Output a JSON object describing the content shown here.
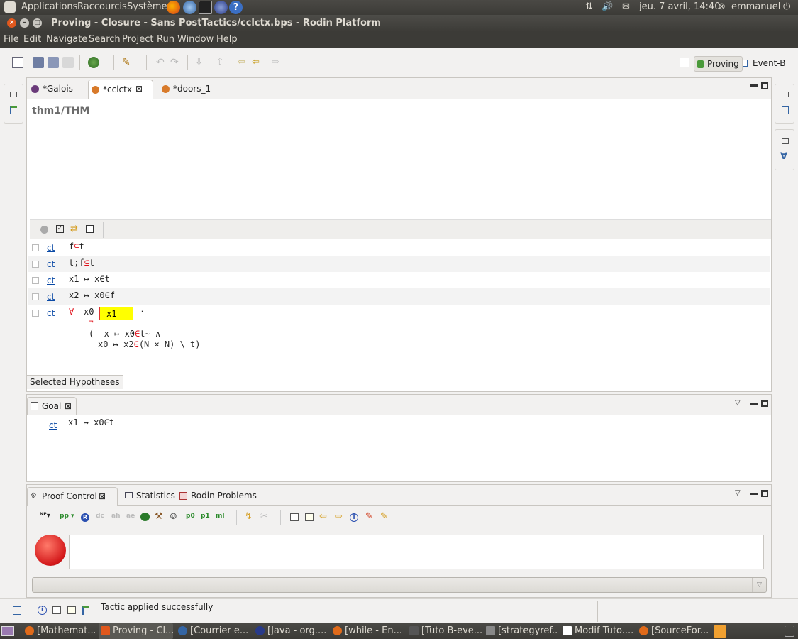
{
  "top_panel": {
    "applications": "Applications",
    "shortcuts": "Raccourcis",
    "system": "Système",
    "datetime": "jeu. 7 avril, 14:40",
    "user": "emmanuel"
  },
  "window": {
    "title": "Proving - Closure - Sans PostTactics/cclctx.bps - Rodin Platform"
  },
  "menu": {
    "items": [
      "File",
      "Edit",
      "Navigate",
      "Search",
      "Project",
      "Run",
      "Window",
      "Help"
    ]
  },
  "perspectives": {
    "proving": "Proving",
    "eventb": "Event-B"
  },
  "editor": {
    "tabs": [
      {
        "label": "*Galois"
      },
      {
        "label": "*cclctx"
      },
      {
        "label": "*doors_1"
      }
    ],
    "title": "thm1/THM",
    "hypotheses_label": "Selected Hypotheses",
    "hypotheses": [
      {
        "link": "ct",
        "pre": "f",
        "red": "⊆",
        "post": "t"
      },
      {
        "link": "ct",
        "pre": "t;f",
        "red": "⊆",
        "post": "t"
      },
      {
        "link": "ct",
        "pre": "x1 ↦ x",
        "red": "∈",
        "post": "t"
      },
      {
        "link": "ct",
        "pre": "x2 ↦ x0",
        "red": "∈",
        "post": "f"
      }
    ],
    "forall": {
      "link": "ct",
      "quantifier": "∀",
      "var": "x0",
      "input_value": "x1",
      "dot": "·",
      "neg": "¬",
      "line1_a": "(  x ↦ x0",
      "line1_red": "∈",
      "line1_b": "t∼ ∧",
      "line2_a": "x0 ↦ x2",
      "line2_red": "∈",
      "line2_b": "(N × N) \\ t)"
    }
  },
  "goal": {
    "tab": "Goal",
    "link": "ct",
    "pre": "x1 ↦ x0",
    "red": "∈",
    "post": "t"
  },
  "proof_control": {
    "tabs": [
      "Proof Control",
      "Statistics",
      "Rodin Problems"
    ],
    "buttons": [
      "pp",
      "dc",
      "ah",
      "ae",
      "p0",
      "p1",
      "ml"
    ],
    "input_value": ""
  },
  "status": {
    "message": "Tactic applied successfully"
  },
  "taskbar": {
    "tasks": [
      "[Mathemat...",
      "Proving - Cl...",
      "[Courrier e...",
      "[Java - org....",
      "[while - En...",
      "[Tuto B-eve...",
      "[strategyref...",
      "Modif Tuto....",
      "[SourceFor..."
    ]
  },
  "colors": {
    "accent_red": "#e0101a",
    "link_blue": "#0b4aa6",
    "highlight_yellow": "#ffff00"
  }
}
